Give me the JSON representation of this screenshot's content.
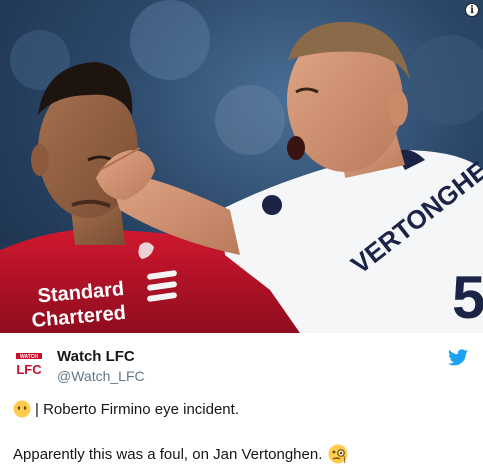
{
  "tweet": {
    "display_name": "Watch LFC",
    "handle": "@Watch_LFC",
    "avatar_text_top": "WATCH",
    "avatar_text_bottom": "LFC",
    "line1": "| Roberto Firmino eye incident.",
    "line2": "Apparently this was a foul, on Jan Vertonghen."
  },
  "photo": {
    "sponsor_line1": "Standard",
    "sponsor_line2": "Chartered",
    "shirt_name": "VERTONGHE",
    "shirt_number": "5",
    "info_icon": "i"
  },
  "colors": {
    "twitter_blue": "#1da1f2",
    "lfc_red": "#c8102e",
    "text": "#14171a",
    "subtext": "#657786"
  },
  "icons": {
    "info": "info-icon",
    "bird": "twitter-bird-icon",
    "emoji_neutral": "no-mouth-face-icon",
    "emoji_monocle": "face-with-monocle-icon"
  }
}
